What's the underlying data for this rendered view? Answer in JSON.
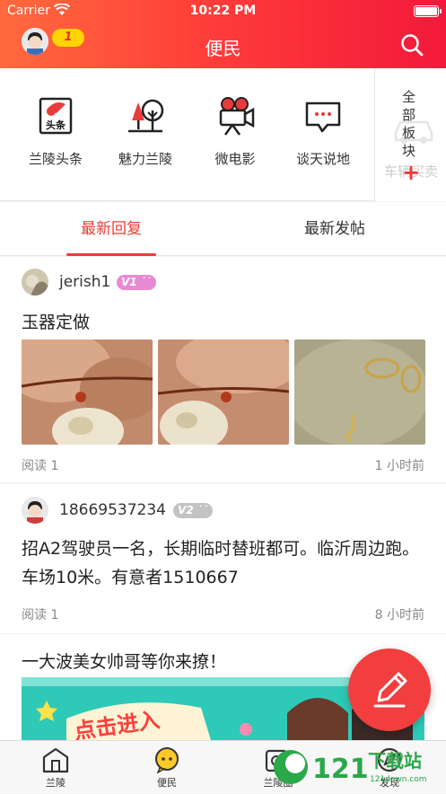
{
  "status_bar": {
    "carrier": "Carrier",
    "time": "10:22 PM"
  },
  "header": {
    "title": "便民",
    "notice_count": "1"
  },
  "quick_nav": {
    "items": [
      {
        "label": "兰陵头条",
        "icon": "headline-icon",
        "icon_text": "头条"
      },
      {
        "label": "魅力兰陵",
        "icon": "trees-icon"
      },
      {
        "label": "微电影",
        "icon": "movie-camera-icon"
      },
      {
        "label": "谈天说地",
        "icon": "chat-bubble-icon"
      }
    ],
    "all_boards": {
      "label": "全部板块",
      "behind_label": "车辆买卖"
    }
  },
  "tabs": [
    {
      "label": "最新回复",
      "active": true
    },
    {
      "label": "最新发帖",
      "active": false
    }
  ],
  "posts": [
    {
      "user": "jerish1",
      "level": "V1",
      "title": "玉器定做",
      "reads": "阅读 1",
      "time": "1 小时前",
      "images": 3
    },
    {
      "user": "18669537234",
      "level": "V2",
      "body": "招A2驾驶员一名，长期临时替班都可。临沂周边跑。车场10米。有意者1510667",
      "reads": "阅读 1",
      "time": "8 小时前"
    }
  ],
  "ad": {
    "title": "一大波美女帅哥等你来撩！",
    "banner_text": "点击进入"
  },
  "tabbar": [
    {
      "label": "兰陵",
      "icon": "house-icon"
    },
    {
      "label": "便民",
      "icon": "chat-bubbles-icon"
    },
    {
      "label": "兰陵圈",
      "icon": "circle-icon"
    },
    {
      "label": "发现",
      "icon": "discover-icon"
    }
  ],
  "watermark": {
    "text": "121下载站",
    "sub": "121down.com"
  },
  "colors": {
    "brand_red": "#ee3a3a",
    "header_start": "#ff6a3d",
    "header_end": "#f3193b",
    "v1_badge": "#e88ad3",
    "v2_badge": "#c3c3c3"
  }
}
